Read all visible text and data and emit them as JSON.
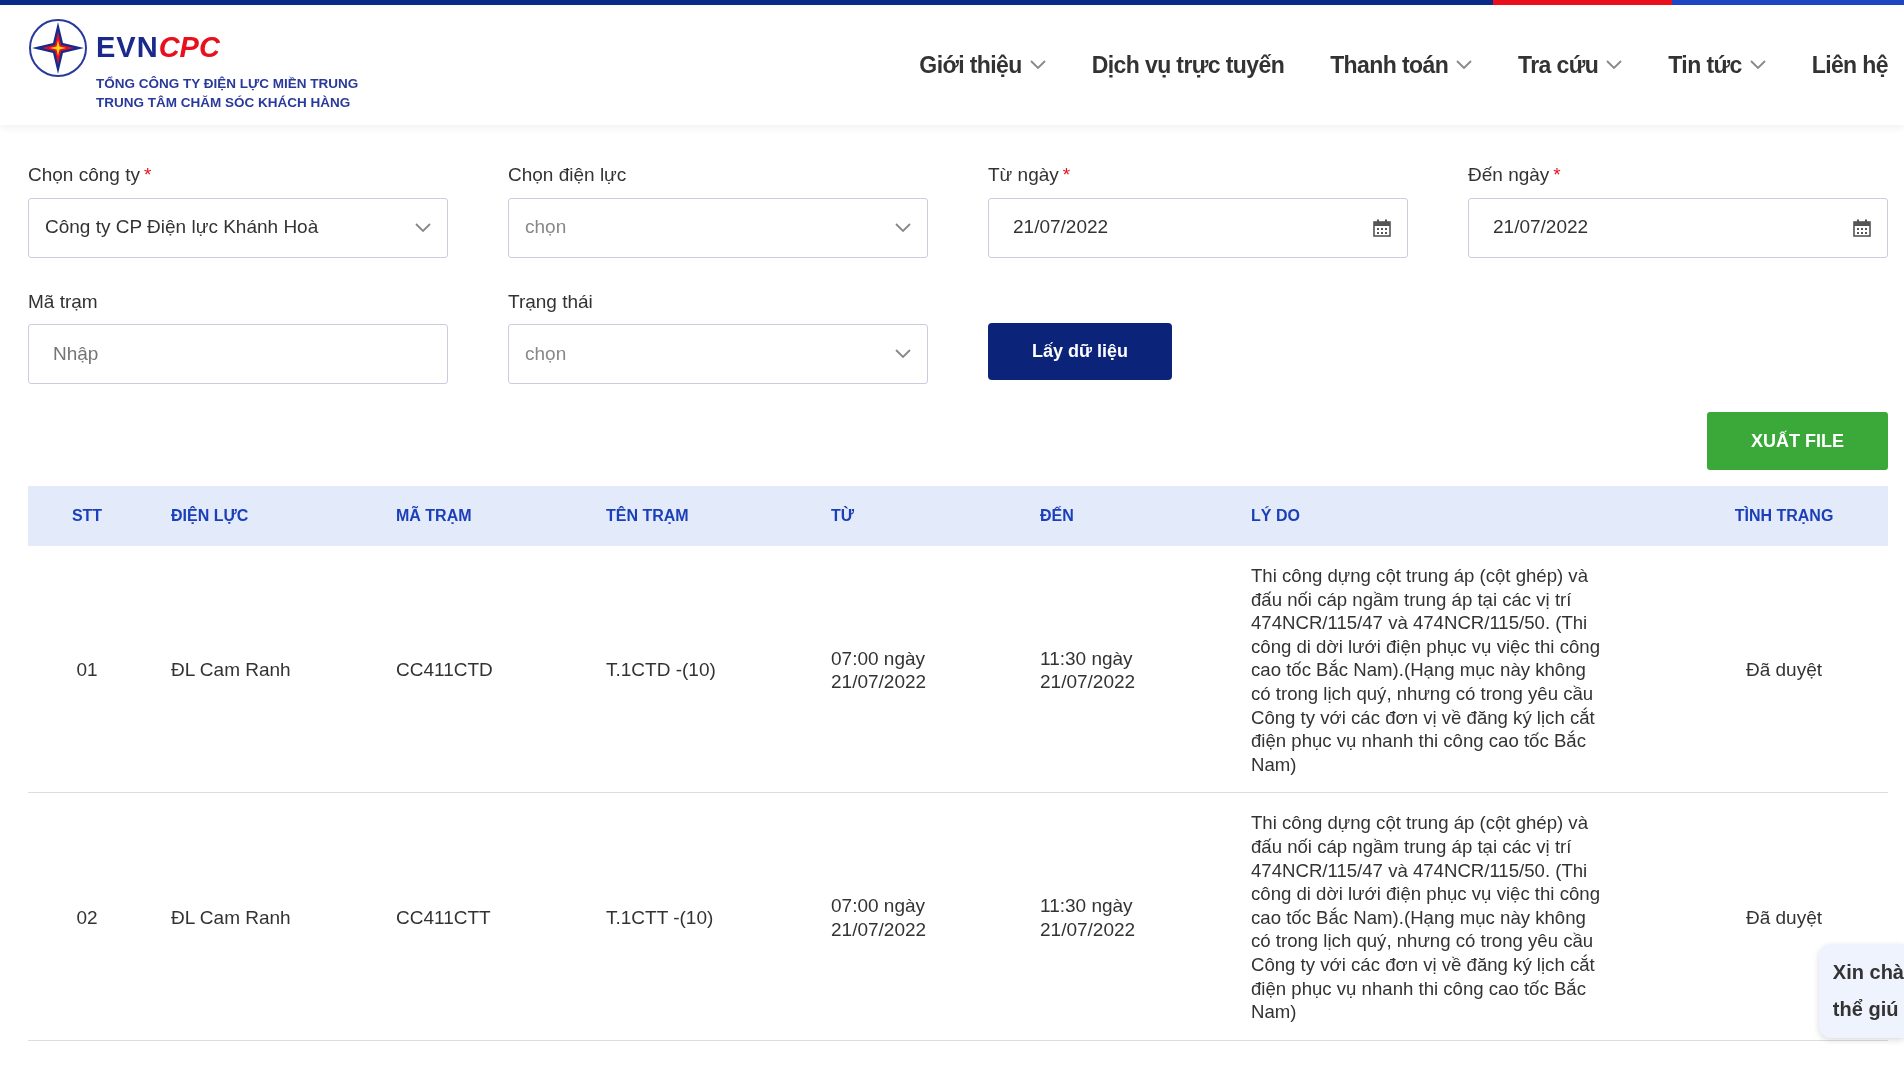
{
  "header": {
    "logo": {
      "brand_main": "EVN",
      "brand_accent": "CPC",
      "line_1": "TỔNG CÔNG TY ĐIỆN LỰC MIỀN TRUNG",
      "line_2": "TRUNG TÂM CHĂM SÓC KHÁCH HÀNG"
    },
    "nav": [
      {
        "label": "Giới thiệu",
        "dropdown": true
      },
      {
        "label": "Dịch vụ trực tuyến",
        "dropdown": false
      },
      {
        "label": "Thanh toán",
        "dropdown": true
      },
      {
        "label": "Tra cứu",
        "dropdown": true
      },
      {
        "label": "Tin tức",
        "dropdown": true
      },
      {
        "label": "Liên hệ",
        "dropdown": false
      }
    ]
  },
  "filters": [
    [
      {
        "kind": "select",
        "label": "Chọn công ty",
        "required_mark": "*",
        "value": "Công ty CP Điện lực Khánh Hoà"
      },
      {
        "kind": "select",
        "label": "Chọn điện lực",
        "placeholder": "chọn"
      },
      {
        "kind": "date",
        "label": "Từ ngày",
        "required_mark": "*",
        "value": "21/07/2022"
      },
      {
        "kind": "date",
        "label": "Đến ngày",
        "required_mark": "*",
        "value": "21/07/2022"
      }
    ],
    [
      {
        "kind": "input",
        "label": "Mã trạm",
        "placeholder": "Nhập"
      },
      {
        "kind": "select",
        "label": "Trạng thái",
        "placeholder": "chọn"
      },
      {
        "kind": "button",
        "label": "Lấy dữ liệu"
      }
    ]
  ],
  "export_button": "XUẤT FILE",
  "table": {
    "columns": [
      "STT",
      "ĐIỆN LỰC",
      "MÃ TRẠM",
      "TÊN TRẠM",
      "TỪ",
      "ĐẾN",
      "LÝ DO",
      "TÌNH TRẠNG"
    ],
    "rows": [
      [
        "01",
        "ĐL Cam Ranh",
        "CC411CTD",
        "T.1CTD -(10)",
        "07:00 ngày 21/07/2022",
        "11:30 ngày 21/07/2022",
        "Thi công dựng cột trung áp (cột ghép) và đấu nối cáp ngầm trung áp tại các vị trí 474NCR/115/47 và 474NCR/115/50. (Thi công di dời lưới điện phục vụ việc thi công cao tốc Bắc Nam).(Hạng mục này không có trong lịch quý, nhưng có trong yêu cầu Công ty với các đơn vị về đăng ký lịch cắt điện phục vụ nhanh thi công cao tốc Bắc Nam)",
        "Đã duyệt"
      ],
      [
        "02",
        "ĐL Cam Ranh",
        "CC411CTT",
        "T.1CTT -(10)",
        "07:00 ngày 21/07/2022",
        "11:30 ngày 21/07/2022",
        "Thi công dựng cột trung áp (cột ghép) và đấu nối cáp ngầm trung áp tại các vị trí 474NCR/115/47 và 474NCR/115/50. (Thi công di dời lưới điện phục vụ việc thi công cao tốc Bắc Nam).(Hạng mục này không có trong lịch quý, nhưng có trong yêu cầu Công ty với các đơn vị về đăng ký lịch cắt điện phục vụ nhanh thi công cao tốc Bắc Nam)",
        "Đã duyệt"
      ]
    ]
  },
  "chat_bubble": [
    "Xin chà",
    "thể giú"
  ]
}
